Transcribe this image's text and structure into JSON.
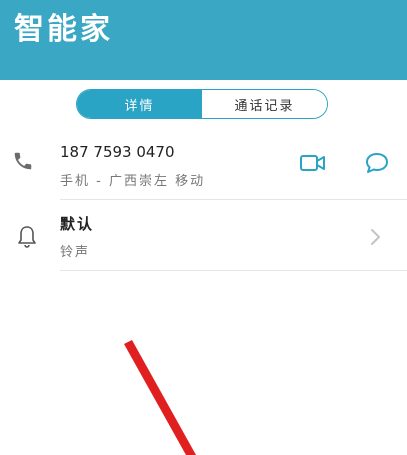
{
  "app": {
    "title": "智能家"
  },
  "tabs": [
    {
      "label": "详情",
      "active": true
    },
    {
      "label": "通话记录",
      "active": false
    }
  ],
  "contact": {
    "number": "187 7593 0470",
    "subtitle": "手机 - 广西崇左 移动"
  },
  "ringtone": {
    "title": "默认",
    "subtitle": "铃声"
  },
  "colors": {
    "header": "#3aa7c4",
    "accent": "#2aa4c4",
    "annotation_arrow": "#e02020"
  },
  "icons": [
    "phone-icon",
    "video-call-icon",
    "message-icon",
    "bell-icon",
    "chevron-right-icon"
  ]
}
